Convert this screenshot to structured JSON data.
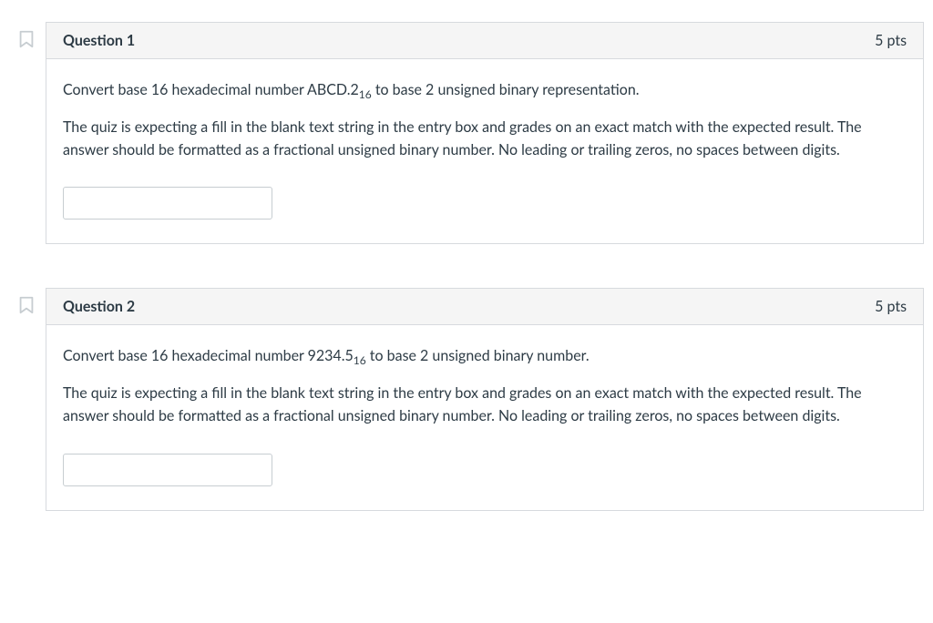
{
  "questions": [
    {
      "title": "Question 1",
      "points": "5 pts",
      "prompt_prefix": "Convert base 16 hexadecimal number ABCD.2",
      "prompt_sub": "16",
      "prompt_suffix": " to base 2 unsigned binary representation.",
      "instructions": "The quiz is expecting a fill in the blank text string in the entry box and grades on an exact match with the expected result. The answer should be formatted as a fractional unsigned binary number. No leading or trailing zeros, no spaces between digits.",
      "answer_value": ""
    },
    {
      "title": "Question 2",
      "points": "5 pts",
      "prompt_prefix": "Convert base 16 hexadecimal number 9234.5",
      "prompt_sub": "16",
      "prompt_suffix": " to base 2 unsigned binary number.",
      "instructions": "The quiz is expecting a fill in the blank text string in the entry box and grades on an exact match with the expected result. The answer should be formatted as a fractional unsigned binary number. No leading or trailing zeros, no spaces between digits.",
      "answer_value": ""
    }
  ]
}
